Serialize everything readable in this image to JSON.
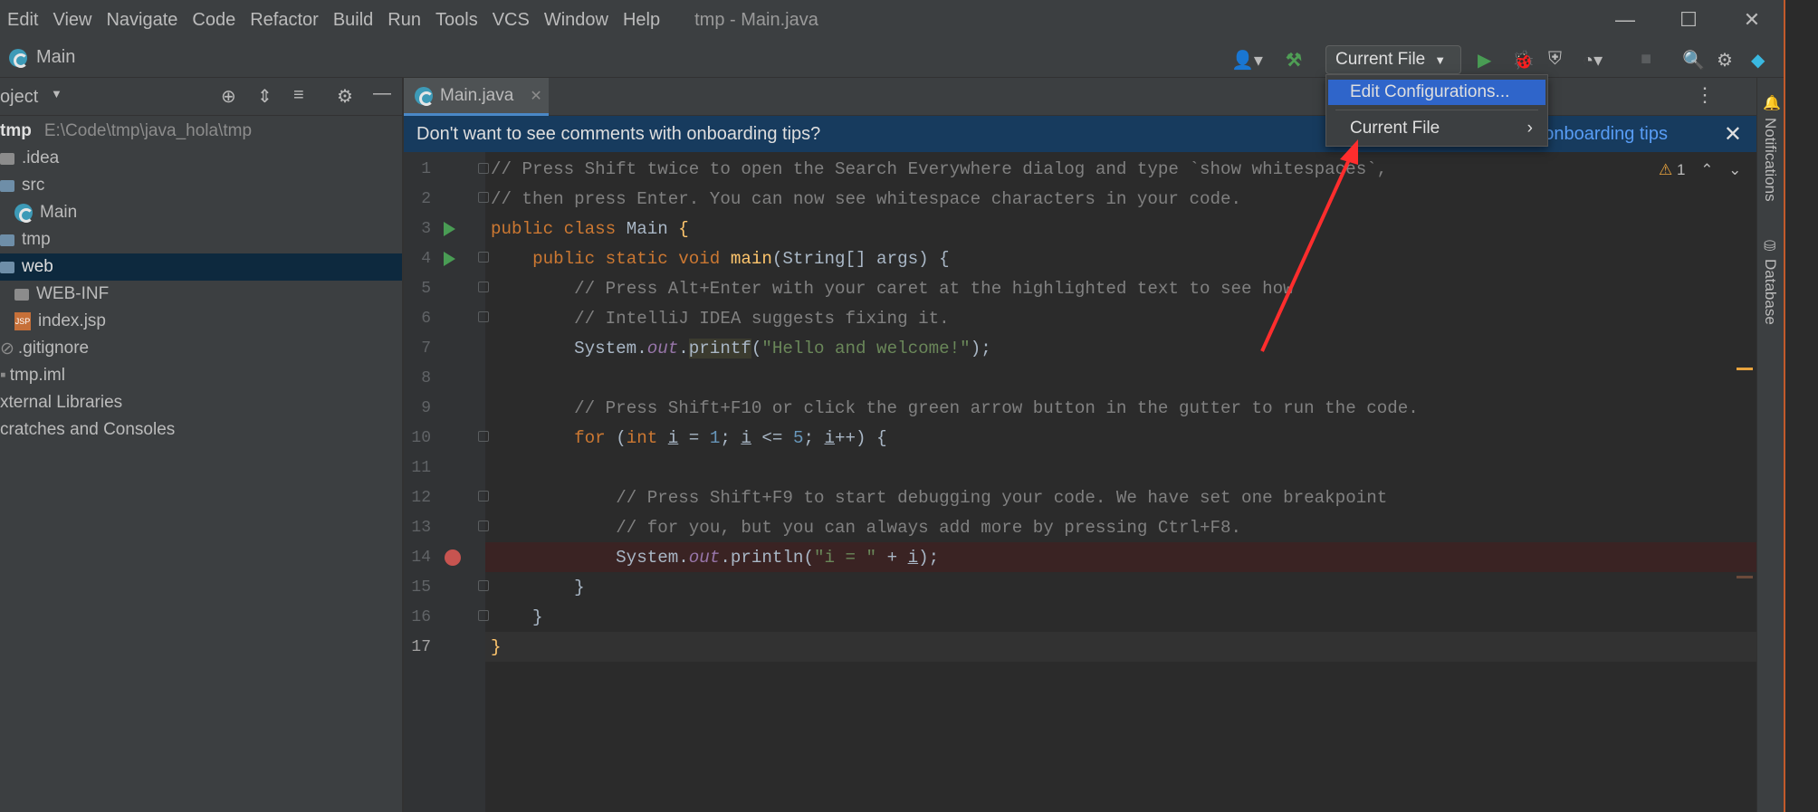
{
  "window": {
    "title": "tmp - Main.java",
    "menu": [
      "Edit",
      "View",
      "Navigate",
      "Code",
      "Refactor",
      "Build",
      "Run",
      "Tools",
      "VCS",
      "Window",
      "Help"
    ],
    "controls": {
      "minimize": "—",
      "maximize": "☐",
      "close": "✕"
    }
  },
  "navbar": {
    "breadcrumb": "Main",
    "run_config": "Current File"
  },
  "project": {
    "header": "oject",
    "tree": [
      {
        "label": "tmp",
        "extra": "E:\\Code\\tmp\\java_hola\\tmp",
        "type": "root"
      },
      {
        "label": ".idea",
        "type": "folder"
      },
      {
        "label": "src",
        "type": "folder"
      },
      {
        "label": "Main",
        "type": "class"
      },
      {
        "label": "tmp",
        "type": "folder"
      },
      {
        "label": "web",
        "type": "folder",
        "selected": true
      },
      {
        "label": "WEB-INF",
        "type": "folder"
      },
      {
        "label": "index.jsp",
        "type": "jsp"
      },
      {
        "label": ".gitignore",
        "type": "file"
      },
      {
        "label": "tmp.iml",
        "type": "file"
      },
      {
        "label": "xternal Libraries",
        "type": "lib"
      },
      {
        "label": "cratches and Consoles",
        "type": "lib"
      }
    ]
  },
  "editor": {
    "tab": "Main.java",
    "banner_text": "Don't want to see comments with onboarding tips?",
    "banner_link": "le onboarding tips",
    "warning_count": "1",
    "line_numbers": [
      "1",
      "2",
      "3",
      "4",
      "5",
      "6",
      "7",
      "8",
      "9",
      "10",
      "11",
      "12",
      "13",
      "14",
      "15",
      "16",
      "17"
    ]
  },
  "dropdown": {
    "items": [
      "Edit Configurations...",
      "Current File"
    ]
  },
  "right_stripe": {
    "notifications": "Notifications",
    "database": "Database"
  },
  "colors": {
    "accent": "#2f65ca",
    "banner": "#173b5e",
    "arrow": "#ff2d2d"
  }
}
